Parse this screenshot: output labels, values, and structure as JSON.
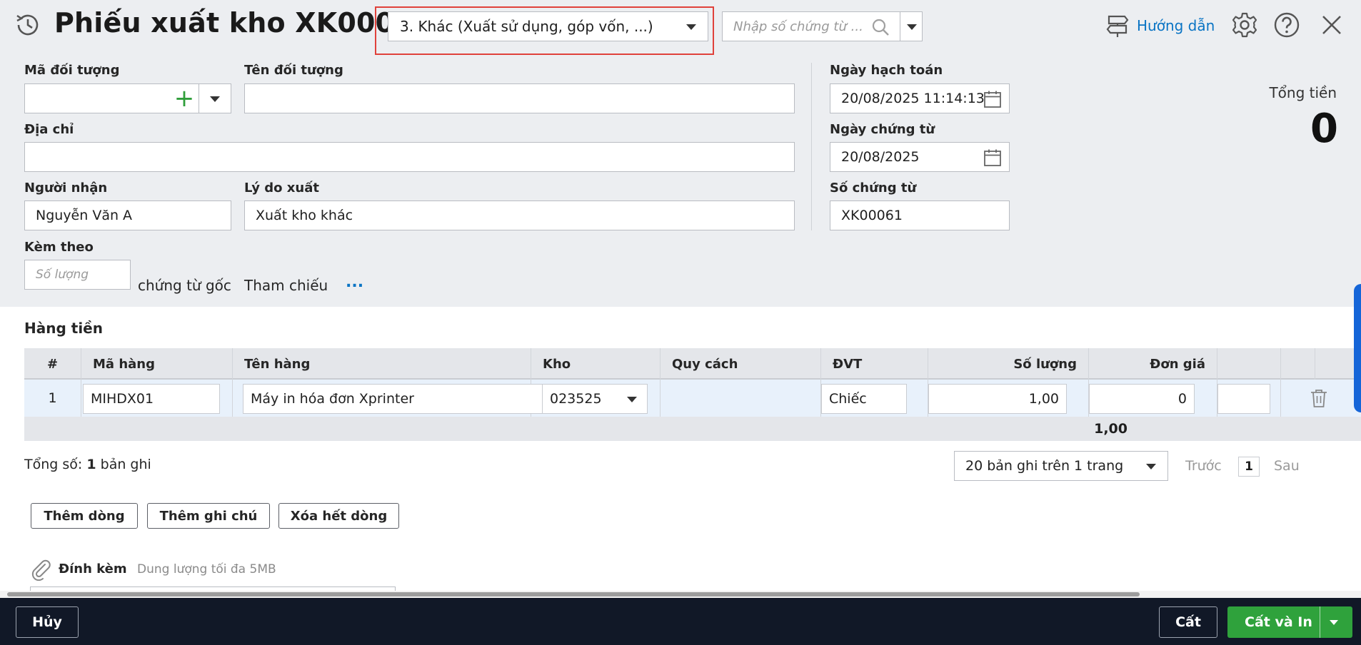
{
  "header": {
    "title": "Phiếu xuất kho XK00061",
    "type_selected": "3. Khác (Xuất sử dụng, góp vốn, ...)",
    "doc_search_placeholder": "Nhập số chứng từ ...",
    "guide_label": "Hướng dẫn"
  },
  "form": {
    "object_code": {
      "label": "Mã đối tượng",
      "value": ""
    },
    "object_name": {
      "label": "Tên đối tượng",
      "value": ""
    },
    "address": {
      "label": "Địa chỉ",
      "value": ""
    },
    "receiver": {
      "label": "Người nhận",
      "value": "Nguyễn Văn A"
    },
    "reason": {
      "label": "Lý do xuất",
      "value": "Xuất kho khác"
    },
    "attached": {
      "label": "Kèm theo",
      "placeholder": "Số lượng",
      "suffix": "chứng từ gốc"
    },
    "reference": {
      "label": "Tham chiếu",
      "more": "..."
    },
    "posting_date": {
      "label": "Ngày hạch toán",
      "value": "20/08/2025 11:14:13"
    },
    "doc_date": {
      "label": "Ngày chứng từ",
      "value": "20/08/2025"
    },
    "doc_no": {
      "label": "Số chứng từ",
      "value": "XK00061"
    },
    "total": {
      "label": "Tổng tiền",
      "value": "0"
    }
  },
  "grid": {
    "section_title": "Hàng tiền",
    "columns": [
      "#",
      "Mã hàng",
      "Tên hàng",
      "Kho",
      "Quy cách",
      "ĐVT",
      "Số lượng",
      "Đơn giá"
    ],
    "rows": [
      {
        "no": "1",
        "code": "MIHDX01",
        "name": "Máy in hóa đơn Xprinter",
        "warehouse": "023525",
        "spec": "",
        "unit": "Chiếc",
        "qty": "1,00",
        "price": "0"
      }
    ],
    "sum_qty": "1,00"
  },
  "pager": {
    "record_prefix": "Tổng số:",
    "record_count": "1",
    "record_suffix": "bản ghi",
    "page_size": "20 bản ghi trên 1 trang",
    "prev": "Trước",
    "page": "1",
    "next": "Sau"
  },
  "actions": {
    "add_row": "Thêm dòng",
    "add_note": "Thêm ghi chú",
    "clear_rows": "Xóa hết dòng"
  },
  "attachment": {
    "label": "Đính kèm",
    "note": "Dung lượng tối đa 5MB"
  },
  "footer": {
    "cancel": "Hủy",
    "save": "Cất",
    "save_print": "Cất và In"
  },
  "colors": {
    "accent_blue": "#0a74c4",
    "save_green": "#2fa23c",
    "highlight_red": "#e0413b",
    "footer_bg": "#111827"
  }
}
